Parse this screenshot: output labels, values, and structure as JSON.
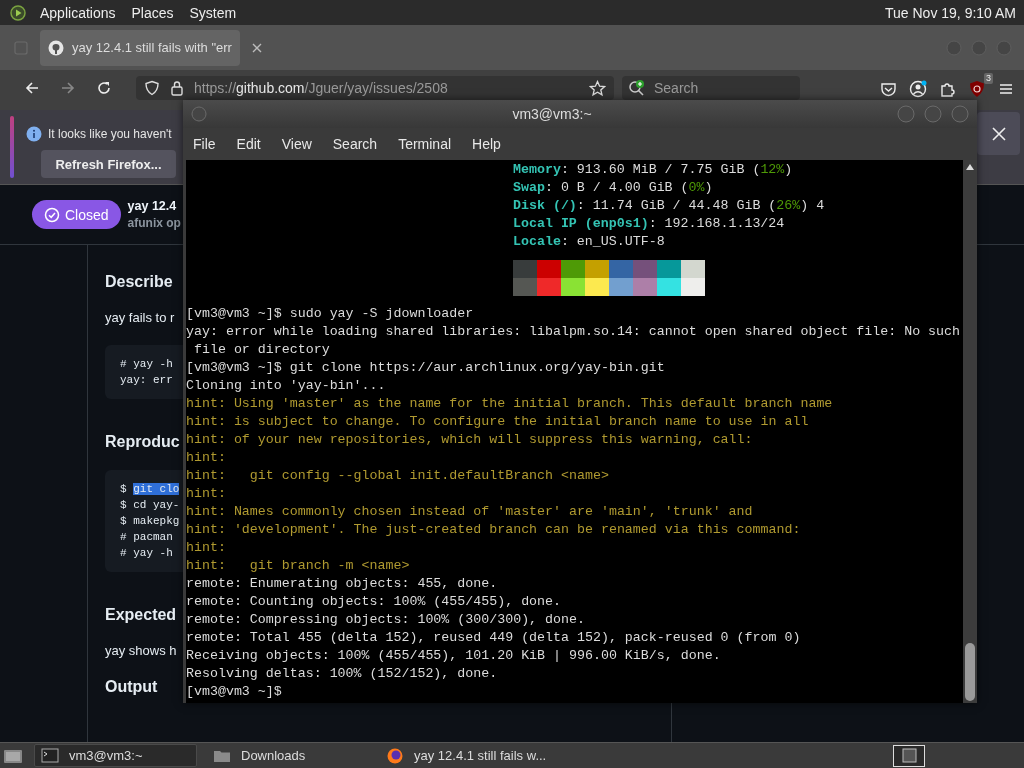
{
  "top_panel": {
    "menus": [
      "Applications",
      "Places",
      "System"
    ],
    "clock": "Tue Nov 19, 9:10 AM"
  },
  "browser": {
    "tab": {
      "title": "yay 12.4.1 still fails with \"err",
      "selected": true
    },
    "url": {
      "parts": [
        {
          "kind": "dim",
          "text": "https://"
        },
        {
          "kind": "host",
          "text": "github.com"
        },
        {
          "kind": "dim",
          "text": "/Jguer/yay/issues/2508"
        }
      ]
    },
    "search": {
      "placeholder": "Search"
    },
    "extension_badge": "3",
    "notification": {
      "message": "It looks like you haven't",
      "button": "Refresh Firefox..."
    },
    "issue": {
      "status": "Closed",
      "title": "yay 12.4",
      "byline": "afunix op"
    },
    "sections": [
      {
        "heading": "Describe",
        "text": "yay fails to r",
        "code": [
          {
            "prompt": "#",
            "text": "yay -h",
            "selected": false
          },
          {
            "text": "yay: err",
            "selected": false
          }
        ]
      },
      {
        "heading": "Reproduc",
        "code": [
          {
            "prompt": "$",
            "text": "git clo",
            "selected": true
          },
          {
            "prompt": "$",
            "text": "cd yay-",
            "selected": false
          },
          {
            "prompt": "$",
            "text": "makepkg",
            "selected": false
          },
          {
            "prompt": "#",
            "text": "pacman",
            "selected": false
          },
          {
            "prompt": "#",
            "text": "yay -h",
            "selected": false
          }
        ]
      },
      {
        "heading": "Expected",
        "text": "yay shows h"
      },
      {
        "heading": "Output"
      }
    ]
  },
  "terminal": {
    "title": "vm3@vm3:~",
    "menus": [
      "File",
      "Edit",
      "View",
      "Search",
      "Terminal",
      "Help"
    ],
    "lines": [
      {
        "kind": "info",
        "segments": [
          {
            "kind": "key",
            "text": "Memory"
          },
          {
            "kind": "value",
            "text": ": 913.60 MiB / 7.75 GiB ("
          },
          {
            "kind": "accent",
            "text": "12%"
          },
          {
            "kind": "value",
            "text": ")"
          }
        ]
      },
      {
        "kind": "info",
        "segments": [
          {
            "kind": "key",
            "text": "Swap"
          },
          {
            "kind": "value",
            "text": ": 0 B / 4.00 GiB ("
          },
          {
            "kind": "accent",
            "text": "0%"
          },
          {
            "kind": "value",
            "text": ")"
          }
        ]
      },
      {
        "kind": "info",
        "segments": [
          {
            "kind": "key",
            "text": "Disk (/)"
          },
          {
            "kind": "value",
            "text": ": 11.74 GiB / 44.48 GiB ("
          },
          {
            "kind": "accent",
            "text": "26%"
          },
          {
            "kind": "value",
            "text": ") 4"
          }
        ]
      },
      {
        "kind": "info",
        "segments": [
          {
            "kind": "key",
            "text": "Local IP (enp0s1)"
          },
          {
            "kind": "value",
            "text": ": 192.168.1.13/24"
          }
        ]
      },
      {
        "kind": "info",
        "segments": [
          {
            "kind": "key",
            "text": "Locale"
          },
          {
            "kind": "value",
            "text": ": en_US.UTF-8"
          }
        ]
      },
      {
        "kind": "palette",
        "swatches": [
          {
            "color": "#383c3c"
          },
          {
            "color": "#cc0000"
          },
          {
            "color": "#4e9a06"
          },
          {
            "color": "#c4a000"
          },
          {
            "color": "#3465a4"
          },
          {
            "color": "#75507b"
          },
          {
            "color": "#06989a"
          },
          {
            "color": "#d3d7cf"
          },
          {
            "color": "#555753"
          },
          {
            "color": "#ef2929"
          },
          {
            "color": "#8ae234"
          },
          {
            "color": "#fce94f"
          },
          {
            "color": "#729fcf"
          },
          {
            "color": "#ad7fa8"
          },
          {
            "color": "#34e2e2"
          },
          {
            "color": "#eeeeec"
          }
        ]
      },
      {
        "kind": "prompt",
        "text": "[vm3@vm3 ~]$ sudo yay -S jdownloader"
      },
      {
        "kind": "output",
        "text": "yay: error while loading shared libraries: libalpm.so.14: cannot open shared object file: No such"
      },
      {
        "kind": "output",
        "text": " file or directory"
      },
      {
        "kind": "prompt",
        "text": "[vm3@vm3 ~]$ git clone https://aur.archlinux.org/yay-bin.git"
      },
      {
        "kind": "output",
        "text": "Cloning into 'yay-bin'..."
      },
      {
        "kind": "hint",
        "text": "hint: Using 'master' as the name for the initial branch. This default branch name"
      },
      {
        "kind": "hint",
        "text": "hint: is subject to change. To configure the initial branch name to use in all"
      },
      {
        "kind": "hint",
        "text": "hint: of your new repositories, which will suppress this warning, call:"
      },
      {
        "kind": "hint",
        "text": "hint:"
      },
      {
        "kind": "hint",
        "text": "hint:   git config --global init.defaultBranch <name>"
      },
      {
        "kind": "hint",
        "text": "hint:"
      },
      {
        "kind": "hint",
        "text": "hint: Names commonly chosen instead of 'master' are 'main', 'trunk' and"
      },
      {
        "kind": "hint",
        "text": "hint: 'development'. The just-created branch can be renamed via this command:"
      },
      {
        "kind": "hint",
        "text": "hint:"
      },
      {
        "kind": "hint",
        "text": "hint:   git branch -m <name>"
      },
      {
        "kind": "output",
        "text": "remote: Enumerating objects: 455, done."
      },
      {
        "kind": "output",
        "text": "remote: Counting objects: 100% (455/455), done."
      },
      {
        "kind": "output",
        "text": "remote: Compressing objects: 100% (300/300), done."
      },
      {
        "kind": "output",
        "text": "remote: Total 455 (delta 152), reused 449 (delta 152), pack-reused 0 (from 0)"
      },
      {
        "kind": "output",
        "text": "Receiving objects: 100% (455/455), 101.20 KiB | 996.00 KiB/s, done."
      },
      {
        "kind": "output",
        "text": "Resolving deltas: 100% (152/152), done."
      },
      {
        "kind": "prompt",
        "text": "[vm3@vm3 ~]$"
      }
    ]
  },
  "taskbar": {
    "tasks": [
      {
        "kind": "terminal",
        "label": "vm3@vm3:~",
        "selected": true
      },
      {
        "kind": "folder",
        "label": "Downloads",
        "selected": false
      },
      {
        "kind": "browser",
        "label": "yay 12.4.1 still fails w...",
        "selected": false
      }
    ]
  }
}
